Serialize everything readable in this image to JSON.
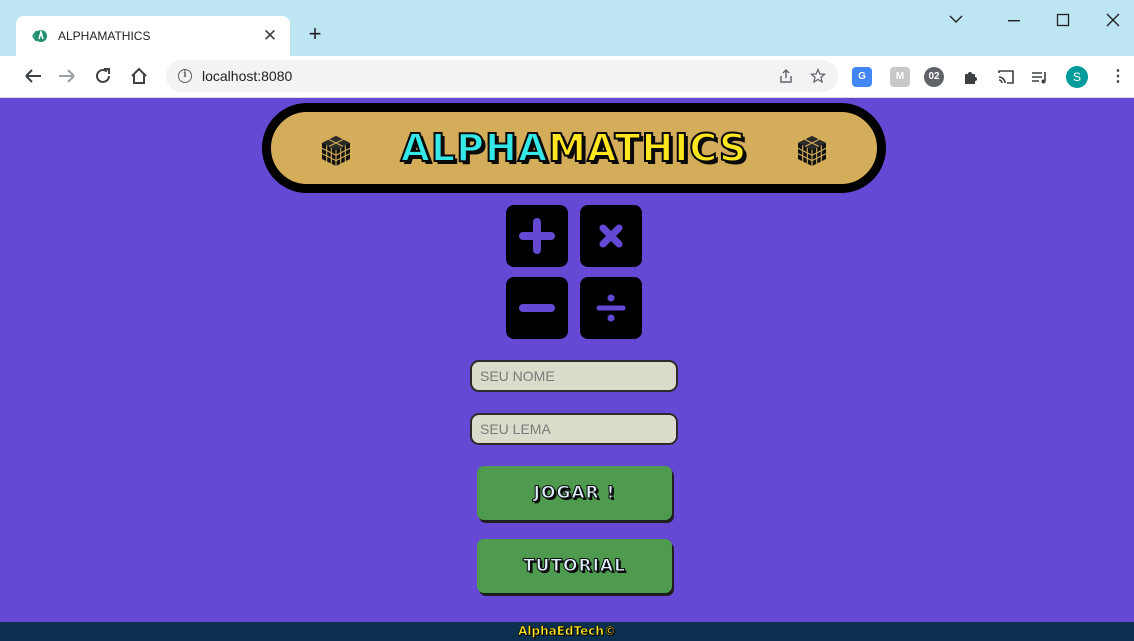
{
  "browser": {
    "tab_title": "ALPHAMATHICS",
    "tab_close": "✕",
    "new_tab": "+",
    "url": "localhost:8080",
    "icons": {
      "favicon": "alphamathics-favicon",
      "back": "back-arrow-icon",
      "forward": "forward-arrow-icon",
      "reload": "reload-icon",
      "home": "home-icon",
      "share": "share-icon",
      "bookmark": "star-icon"
    },
    "profile_initial": "S"
  },
  "page": {
    "title_part1": "ALPHA",
    "title_part2": "MATHICS",
    "operations": [
      "plus",
      "times",
      "minus",
      "divide"
    ],
    "name_placeholder": "SEU NOME",
    "motto_placeholder": "SEU LEMA",
    "play_button": "JOGAR !",
    "tutorial_button": "TUTORIAL",
    "footer": "AlphaEdTech©"
  },
  "colors": {
    "background": "#6549d5",
    "banner": "#d4ad5a",
    "title_alpha": "#33e8e6",
    "title_mathics": "#ffe61e",
    "button": "#4e9a4e",
    "footer": "#0a2f4f"
  }
}
